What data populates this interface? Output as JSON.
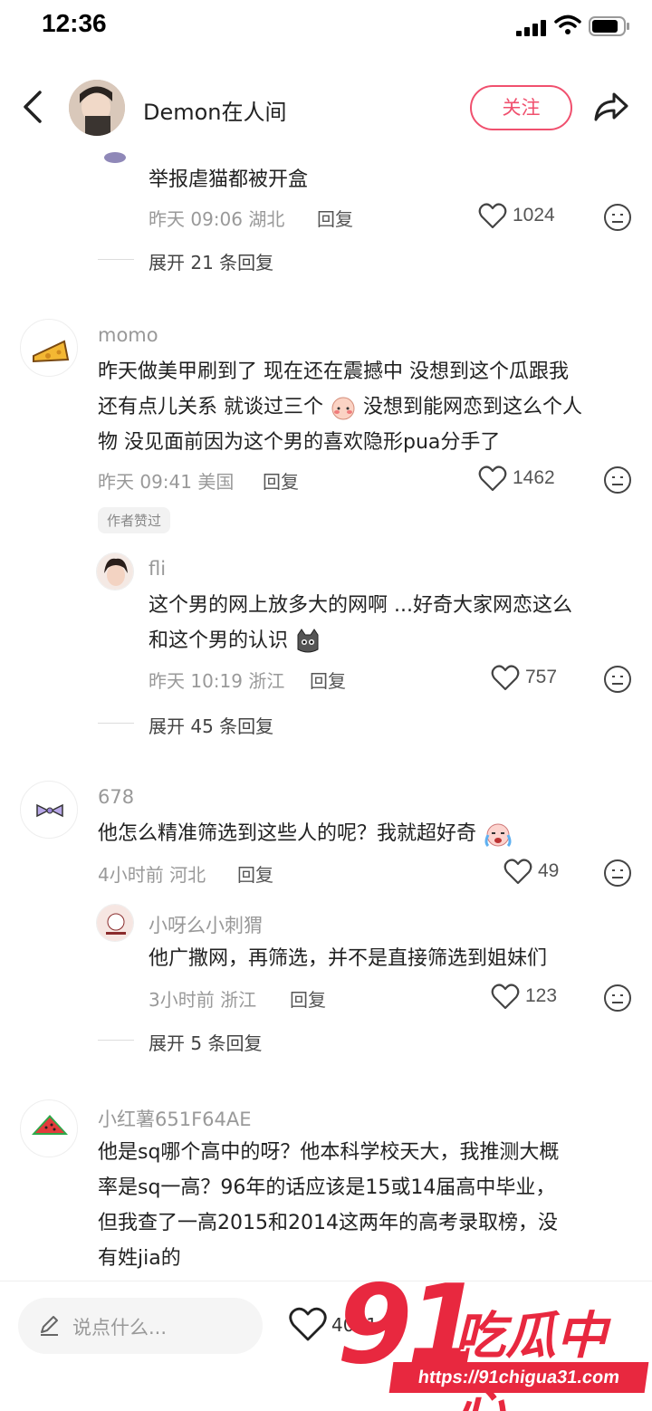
{
  "status_bar": {
    "time": "12:36"
  },
  "header": {
    "author_name": "Demon在人间",
    "follow_label": "关注"
  },
  "comments": [
    {
      "text": "举报虐猫都被开盒",
      "meta": "昨天 09:06 湖北",
      "reply_label": "回复",
      "likes": "1024",
      "expand_label": "展开 21 条回复"
    },
    {
      "user": "momo",
      "text_lines": [
        "昨天做美甲刷到了 现在还在震撼中 没想到这个瓜跟我",
        "还有点儿关系 就谈过三个",
        "没想到能网恋到这么个人",
        "物 没见面前因为这个男的喜欢隐形pua分手了"
      ],
      "meta": "昨天 09:41 美国",
      "reply_label": "回复",
      "likes": "1462",
      "badge": "作者赞过",
      "reply": {
        "user": "fli",
        "text_lines": [
          "这个男的网上放多大的网啊 ...好奇大家网恋这么",
          "和这个男的认识"
        ],
        "meta": "昨天 10:19 浙江",
        "reply_label": "回复",
        "likes": "757"
      },
      "expand_label": "展开 45 条回复"
    },
    {
      "user": "678",
      "text": "他怎么精准筛选到这些人的呢？我就超好奇",
      "meta": "4小时前 河北",
      "reply_label": "回复",
      "likes": "49",
      "reply": {
        "user": "小呀么小刺猬",
        "text": "他广撒网，再筛选，并不是直接筛选到姐妹们",
        "meta": "3小时前 浙江",
        "reply_label": "回复",
        "likes": "123"
      },
      "expand_label": "展开 5 条回复"
    },
    {
      "user": "小红薯651F64AE",
      "text_lines": [
        "他是sq哪个高中的呀？他本科学校天大，我推测大概",
        "率是sq一高？96年的话应该是15或14届高中毕业，",
        "但我查了一高2015和2014这两年的高考录取榜，没",
        "有姓jia的"
      ]
    }
  ],
  "bottom_bar": {
    "input_placeholder": "说点什么...",
    "like_count": "4091"
  },
  "watermark": {
    "number": "91",
    "name": "吃瓜中心",
    "url": "https://91chigua31.com"
  },
  "colors": {
    "accent": "#f0506e",
    "watermark": "#e8283f",
    "secondary_text": "#999999"
  },
  "icons": [
    "back-icon",
    "share-icon",
    "heart-icon",
    "dislike-face-icon",
    "pen-icon",
    "signal-icon",
    "wifi-icon",
    "battery-icon"
  ]
}
